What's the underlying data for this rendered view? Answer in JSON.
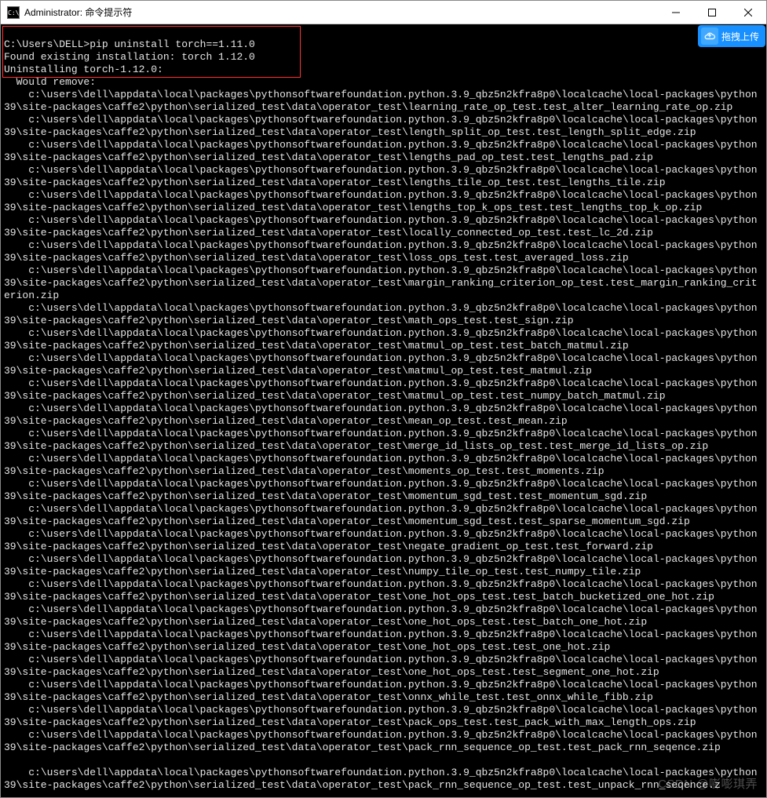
{
  "title_icon_text": "C:\\.",
  "title": "Administrator: 命令提示符",
  "upload_label": "拖拽上传",
  "watermark": "CSDN @嘭嘭琪弄",
  "prompt": "C:\\Users\\DELL>",
  "cmd": "pip uninstall torch==1.11.0",
  "found_line": "Found existing installation: torch 1.12.0",
  "uninstall_line": "Uninstalling torch-1.12.0:",
  "would_remove": "  Would remove:",
  "base_path": "c:\\users\\dell\\appdata\\local\\packages\\pythonsoftwarefoundation.python.3.9_qbz5n2kfra8p0\\localcache\\local-packages\\python39\\site-packages\\caffe2\\python\\serialized_test\\data\\operator_test\\",
  "files": [
    "learning_rate_op_test.test_alter_learning_rate_op.zip",
    "length_split_op_test.test_length_split_edge.zip",
    "lengths_pad_op_test.test_lengths_pad.zip",
    "lengths_tile_op_test.test_lengths_tile.zip",
    "lengths_top_k_ops_test.test_lengths_top_k_op.zip",
    "locally_connected_op_test.test_lc_2d.zip",
    "loss_ops_test.test_averaged_loss.zip",
    "margin_ranking_criterion_op_test.test_margin_ranking_criterion.zip",
    "math_ops_test.test_sign.zip",
    "matmul_op_test.test_batch_matmul.zip",
    "matmul_op_test.test_matmul.zip",
    "matmul_op_test.test_numpy_batch_matmul.zip",
    "mean_op_test.test_mean.zip",
    "merge_id_lists_op_test.test_merge_id_lists_op.zip",
    "moments_op_test.test_moments.zip",
    "momentum_sgd_test.test_momentum_sgd.zip",
    "momentum_sgd_test.test_sparse_momentum_sgd.zip",
    "negate_gradient_op_test.test_forward.zip",
    "numpy_tile_op_test.test_numpy_tile.zip",
    "one_hot_ops_test.test_batch_bucketized_one_hot.zip",
    "one_hot_ops_test.test_batch_one_hot.zip",
    "one_hot_ops_test.test_one_hot.zip",
    "one_hot_ops_test.test_segment_one_hot.zip",
    "onnx_while_test.test_onnx_while_fibb.zip",
    "pack_ops_test.test_pack_with_max_length_ops.zip",
    "pack_rnn_sequence_op_test.test_pack_rnn_seqence.zip"
  ],
  "last_partial": "c:\\users\\dell\\appdata\\local\\packages\\pythonsoftwarefoundation.python.3.9_qbz5n2kfra8p0\\localcache\\local-packages\\python39\\site-packages\\caffe2\\python\\serialized_test\\data\\operator_test\\pack_rnn_sequence_op_test.test_unpack_rnn_seqence.z"
}
